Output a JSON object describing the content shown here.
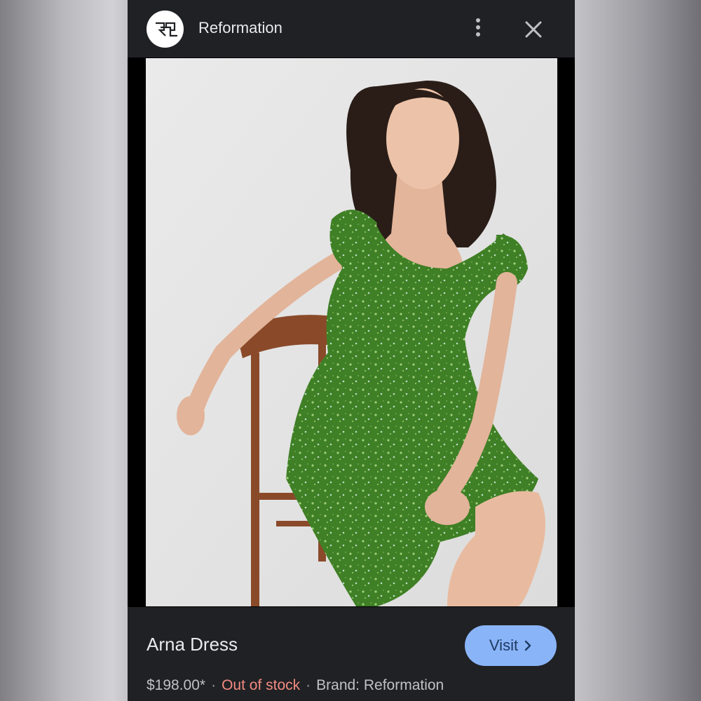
{
  "header": {
    "site_name": "Reformation",
    "logo_icon": "reformation-logo-icon",
    "more_icon": "more-vertical-icon",
    "close_icon": "close-icon"
  },
  "image": {
    "subject": "woman in green floral dress seated on wooden chair"
  },
  "product": {
    "title": "Arna Dress",
    "price": "$198.00*",
    "stock_status": "Out of stock",
    "brand": "Brand: Reformation",
    "separator": "·"
  },
  "actions": {
    "visit_label": "Visit",
    "visit_icon": "chevron-right-icon"
  },
  "colors": {
    "background": "#202124",
    "accent": "#8ab4f8",
    "stock_status": "#f28b82",
    "dress": "#3f7f25"
  }
}
